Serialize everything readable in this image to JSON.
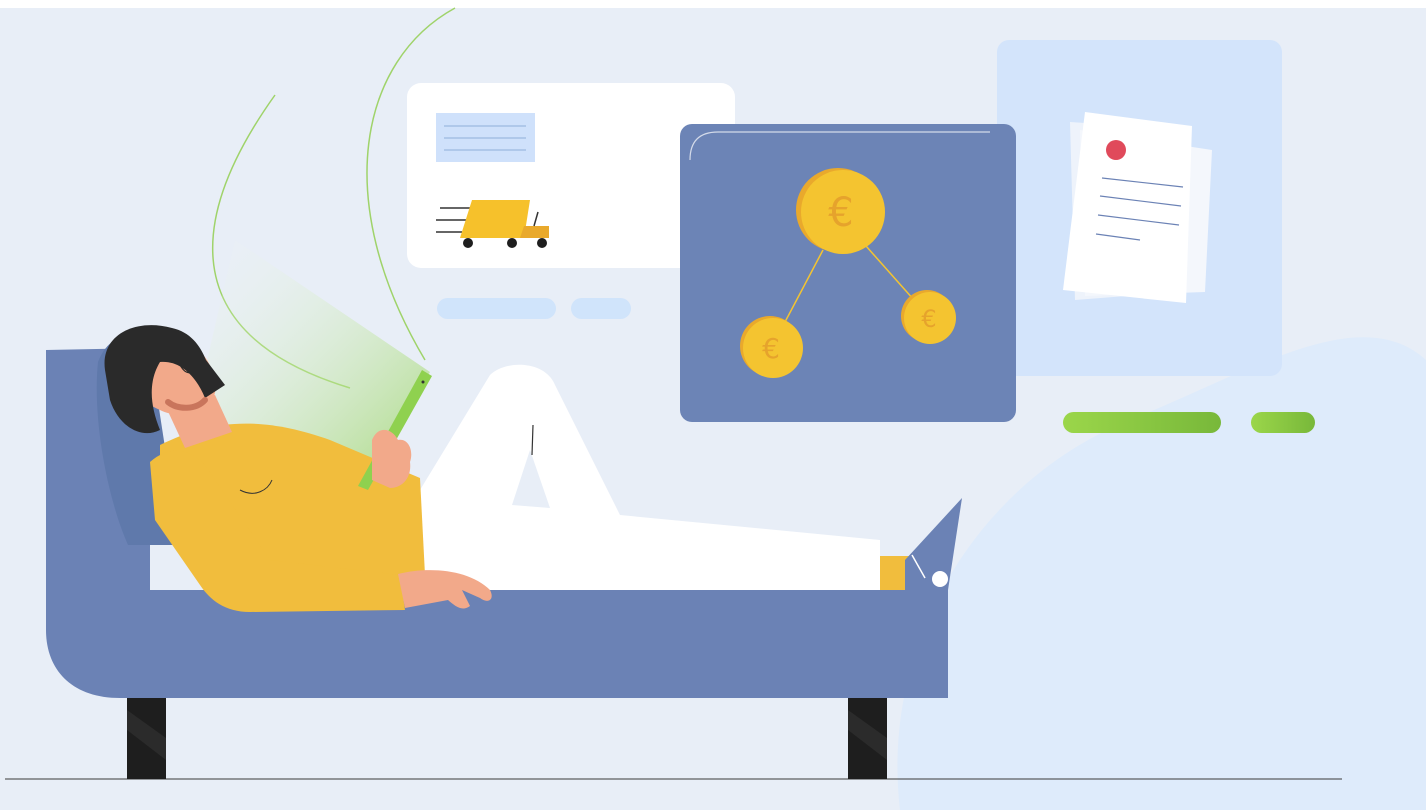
{
  "illustration": {
    "currency_symbol": "€",
    "colors": {
      "background": "#e8eef7",
      "panel_light": "#d3e4fb",
      "panel_dark": "#6c84b6",
      "sofa": "#6b82b5",
      "sofa_legs": "#1e1e1e",
      "coin": "#f4c430",
      "coin_shade": "#e9a92c",
      "truck": "#f6c12b",
      "sweater": "#f1bd3d",
      "skin": "#f2a98a",
      "hair": "#2a2a2a",
      "pants": "#ffffff",
      "tablet": "#8fd14f",
      "progress_green": "#8cc63f",
      "doc_dot": "#e04a5b"
    },
    "icons": [
      "truck-icon",
      "euro-coin-icon",
      "document-icon"
    ]
  }
}
